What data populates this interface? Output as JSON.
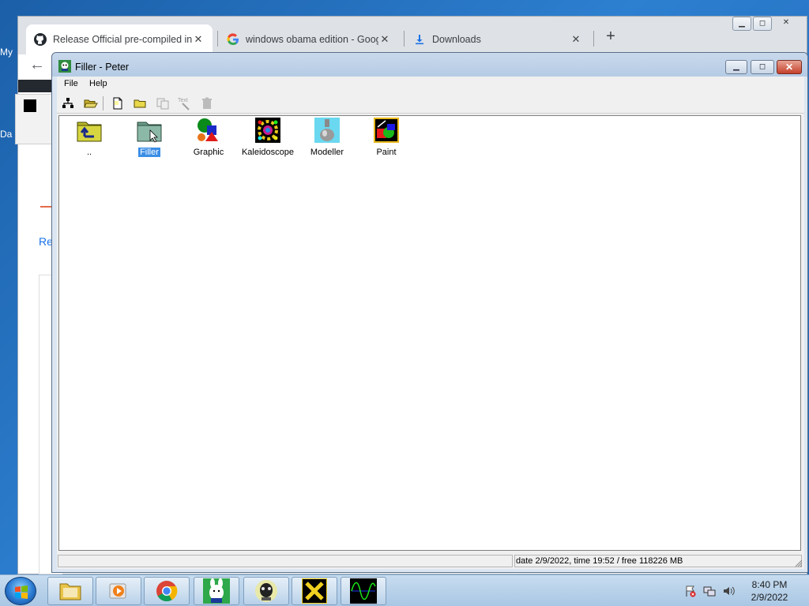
{
  "desktop": {
    "label_my": "My",
    "label_da": "Da"
  },
  "chrome": {
    "tabs": [
      {
        "title": "Release Official pre-compiled ins",
        "icon": "github-icon"
      },
      {
        "title": "windows obama edition - Google",
        "icon": "google-icon"
      },
      {
        "title": "Downloads",
        "icon": "download-icon"
      }
    ],
    "new_tab": "+",
    "back": "←",
    "page_text": "Re"
  },
  "filler": {
    "title": "Filler - Peter",
    "menu": [
      {
        "label": "File"
      },
      {
        "label": "Help"
      }
    ],
    "items": [
      {
        "label": "..",
        "icon": "parent-folder-icon"
      },
      {
        "label": "Filler",
        "icon": "filler-folder-icon",
        "selected": true
      },
      {
        "label": "Graphic",
        "icon": "graphic-icon"
      },
      {
        "label": "Kaleidoscope",
        "icon": "kaleidoscope-icon"
      },
      {
        "label": "Modeller",
        "icon": "modeller-icon"
      },
      {
        "label": "Paint",
        "icon": "paint-icon"
      }
    ],
    "status": "date 2/9/2022, time 19:52 / free 118226 MB"
  },
  "taskbar": {
    "time": "8:40 PM",
    "date": "2/9/2022"
  },
  "colors": {
    "selection": "#3a8ee6",
    "close_red": "#c5412b",
    "folder_yellow": "#c9c43a"
  }
}
